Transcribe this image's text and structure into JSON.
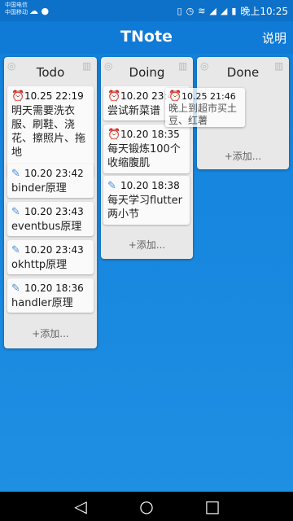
{
  "status_bar": {
    "carrier_1": "中国电信",
    "carrier_2": "中国移动",
    "time": "晚上10:25",
    "battery": "▮"
  },
  "header": {
    "title": "TNote",
    "help_label": "说明"
  },
  "columns": [
    {
      "title": "Todo",
      "add_label": "+添加...",
      "cards": [
        {
          "icon": "alarm-icon",
          "time": "10.25 22:19",
          "text": "明天需要洗衣服、刷鞋、浇花、擦照片、拖地"
        },
        {
          "icon": "pen-icon",
          "time": "10.20 23:42",
          "text": "binder原理"
        },
        {
          "icon": "pen-icon",
          "time": "10.20 23:43",
          "text": "eventbus原理"
        },
        {
          "icon": "pen-icon",
          "time": "10.20 23:43",
          "text": "okhttp原理"
        },
        {
          "icon": "pen-icon",
          "time": "10.20 18:36",
          "text": "handler原理"
        }
      ]
    },
    {
      "title": "Doing",
      "add_label": "+添加...",
      "cards": [
        {
          "icon": "alarm-icon",
          "time": "10.20 23:4",
          "text": "尝试新菜谱"
        },
        {
          "icon": "alarm-icon",
          "time": "10.20 18:35",
          "text": "每天锻炼100个收缩腹肌"
        },
        {
          "icon": "pen-icon",
          "time": "10.20 18:38",
          "text": "每天学习flutter两小节"
        }
      ]
    },
    {
      "title": "Done",
      "add_label": "+添加...",
      "cards": []
    }
  ],
  "dragging_card": {
    "icon": "alarm-icon",
    "time": "10.25 21:46",
    "text": "晚上到超市买土豆、红薯"
  },
  "colors": {
    "background": "#0f7bd6",
    "column": "#e8e8e8",
    "card": "#fafafa",
    "alarm_icon": "#1ca5a0",
    "pen_icon": "#4a8fd6"
  }
}
